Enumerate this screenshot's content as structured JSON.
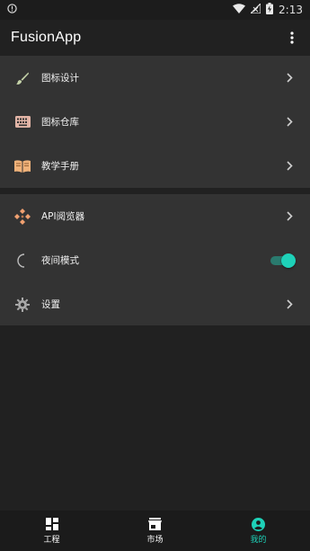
{
  "status_bar": {
    "alert_icon": "alert-circle-icon",
    "wifi_icon": "wifi-icon",
    "signal_icon": "signal-off-icon",
    "battery_icon": "battery-charging-icon",
    "time": "2:13"
  },
  "app_bar": {
    "title": "FusionApp",
    "menu_icon": "more-vert-icon"
  },
  "sections": [
    {
      "items": [
        {
          "label": "图标设计",
          "icon": "brush-icon",
          "icon_color": "#c5d3a9",
          "action": "chevron"
        },
        {
          "label": "图标仓库",
          "icon": "keyboard-icon",
          "icon_color": "#e2b4a6",
          "action": "chevron"
        },
        {
          "label": "教学手册",
          "icon": "book-open-icon",
          "icon_color": "#f0b27a",
          "action": "chevron"
        }
      ]
    },
    {
      "items": [
        {
          "label": "API阅览器",
          "icon": "api-icon",
          "icon_color": "#f0a070",
          "action": "chevron"
        },
        {
          "label": "夜间模式",
          "icon": "moon-icon",
          "icon_color": "#bdbdbd",
          "action": "toggle",
          "toggle_on": true
        },
        {
          "label": "设置",
          "icon": "gear-icon",
          "icon_color": "#a9a9a9",
          "action": "chevron"
        }
      ]
    }
  ],
  "bottom_nav": [
    {
      "label": "工程",
      "icon": "dashboard-icon",
      "active": false
    },
    {
      "label": "市场",
      "icon": "store-icon",
      "active": false
    },
    {
      "label": "我的",
      "icon": "account-circle-icon",
      "active": true
    }
  ],
  "colors": {
    "accent": "#1ed1b8",
    "background": "#212121",
    "card": "#333333",
    "bottom_nav": "#1b1b1b"
  }
}
